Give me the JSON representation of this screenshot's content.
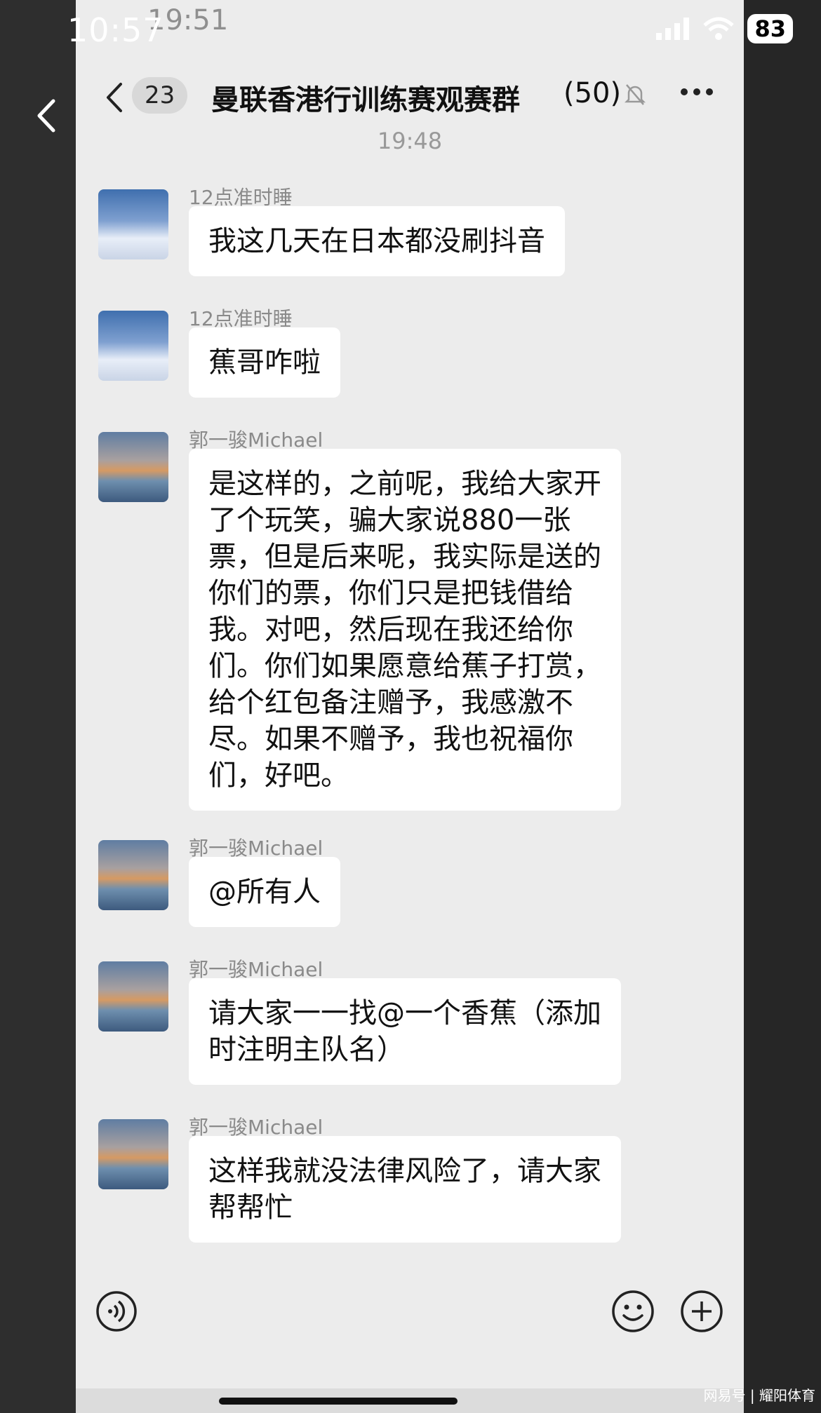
{
  "status_bar": {
    "time": "10:57",
    "ghost_time": "19:51",
    "battery": "83"
  },
  "nav": {
    "unread_count": "23",
    "title": "曼联香港行训练赛观赛群",
    "members": "(50)"
  },
  "time_separator": "19:48",
  "messages": [
    {
      "sender": "12点准时睡",
      "text": "我这几天在日本都没刷抖音"
    },
    {
      "sender": "12点准时睡",
      "text": "蕉哥咋啦"
    },
    {
      "sender": "郭一骏Michael",
      "text": "是这样的，之前呢，我给大家开\n了个玩笑，骗大家说880一张\n票，但是后来呢，我实际是送的\n你们的票，你们只是把钱借给\n我。对吧，然后现在我还给你\n们。你们如果愿意给蕉子打赏，\n给个红包备注赠予，我感激不\n尽。如果不赠予，我也祝福你\n们，好吧。"
    },
    {
      "sender": "郭一骏Michael",
      "text": "@所有人"
    },
    {
      "sender": "郭一骏Michael",
      "text": "请大家一一找@一个香蕉（添加\n时注明主队名）"
    },
    {
      "sender": "郭一骏Michael",
      "text": "这样我就没法律风险了，请大家\n帮帮忙"
    }
  ],
  "watermark": "网易号 | 耀阳体育",
  "icons": {
    "back": "chevron-left-icon",
    "mute": "bell-off-icon",
    "more": "more-dots-icon",
    "voice": "voice-icon",
    "emoji": "emoji-icon",
    "plus": "plus-icon"
  }
}
